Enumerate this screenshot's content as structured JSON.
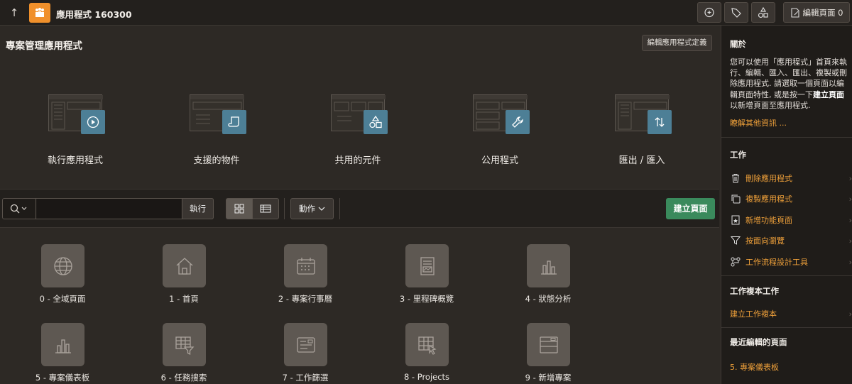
{
  "topbar": {
    "app_title": "應用程式 160300",
    "edit_page_label": "編輯頁面 0"
  },
  "header": {
    "title": "專案管理應用程式",
    "edit_definition_label": "編輯應用程式定義"
  },
  "hero": [
    {
      "label": "執行應用程式",
      "icon": "play-icon"
    },
    {
      "label": "支援的物件",
      "icon": "scroll-icon"
    },
    {
      "label": "共用的元件",
      "icon": "shapes-icon"
    },
    {
      "label": "公用程式",
      "icon": "wrench-icon"
    },
    {
      "label": "匯出 / 匯入",
      "icon": "up-down-arrows-icon"
    }
  ],
  "toolbar": {
    "search_value": "",
    "go_label": "執行",
    "actions_label": "動作",
    "create_page_label": "建立頁面"
  },
  "pages": [
    {
      "label": "0 - 全域頁面",
      "icon": "globe-icon"
    },
    {
      "label": "1 - 首頁",
      "icon": "home-icon"
    },
    {
      "label": "2 - 專案行事曆",
      "icon": "calendar-icon"
    },
    {
      "label": "3 - 里程碑概覽",
      "icon": "report-card-icon"
    },
    {
      "label": "4 - 狀態分析",
      "icon": "bar-chart-icon"
    },
    {
      "label": "5 - 專案儀表板",
      "icon": "bar-chart-icon"
    },
    {
      "label": "6 - 任務搜索",
      "icon": "filter-grid-icon"
    },
    {
      "label": "7 - 工作篩選",
      "icon": "form-icon"
    },
    {
      "label": "8 - Projects",
      "icon": "grid-pointer-icon"
    },
    {
      "label": "9 - 新增專案",
      "icon": "dialog-icon"
    }
  ],
  "sidebar": {
    "about_heading": "關於",
    "about_text_1": "您可以使用「應用程式」首頁來執行、編輯、匯入、匯出、複製或刪除應用程式. 請選取一個頁面以編輯頁面特性, 或是按一下",
    "about_bold_1": "建立頁面",
    "about_text_2": "以新增頁面至應用程式.",
    "learn_more": "瞭解其他資訊 ...",
    "tasks_heading": "工作",
    "tasks": [
      {
        "label": "刪除應用程式",
        "icon": "trash-icon"
      },
      {
        "label": "複製應用程式",
        "icon": "copy-icon"
      },
      {
        "label": "新增功能頁面",
        "icon": "page-star-icon"
      },
      {
        "label": "按面向瀏覽",
        "icon": "funnel-icon"
      },
      {
        "label": "工作流程設計工具",
        "icon": "workflow-icon"
      }
    ],
    "copy_heading": "工作複本工作",
    "copy_link": "建立工作複本",
    "recent_heading": "最近編輯的頁面",
    "recent_link": "5. 專案儀表板"
  }
}
